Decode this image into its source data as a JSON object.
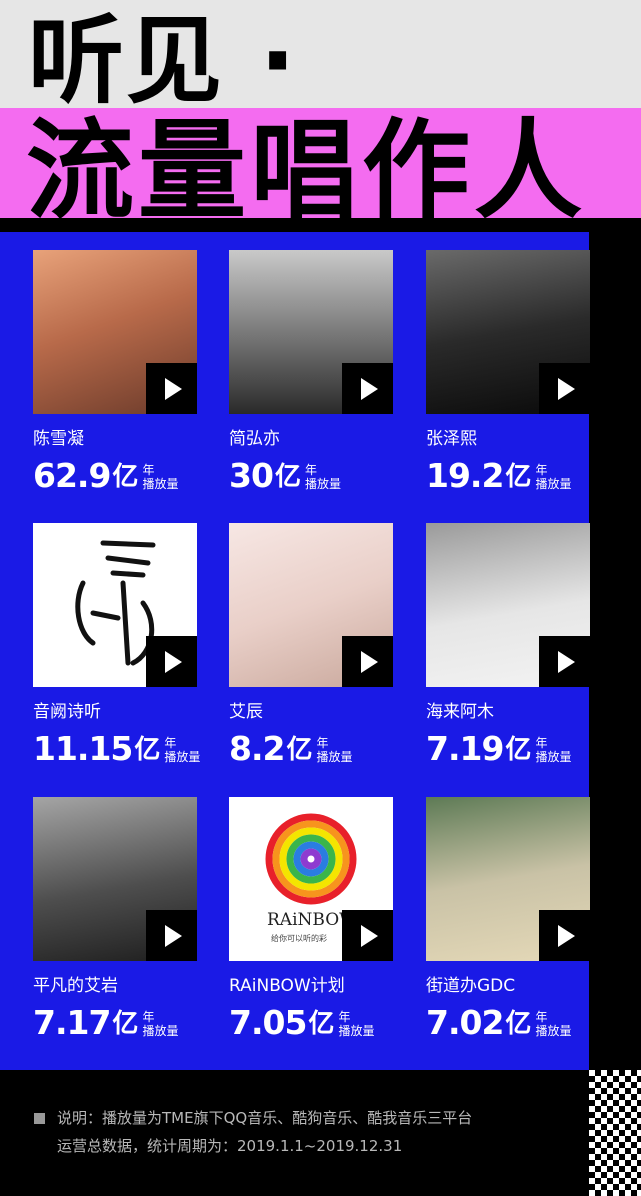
{
  "header": {
    "title_line1": "听见 ·",
    "title_line2": "流量唱作人"
  },
  "colors": {
    "panel": "#1a1ae6",
    "accent_pink": "#f46cf0",
    "header_gray": "#e6e6e6"
  },
  "artists": [
    {
      "name": "陈雪凝",
      "value": "62.9",
      "unit": "亿",
      "label_top": "年",
      "label_bottom": "播放量"
    },
    {
      "name": "简弘亦",
      "value": "30",
      "unit": "亿",
      "label_top": "年",
      "label_bottom": "播放量"
    },
    {
      "name": "张泽熙",
      "value": "19.2",
      "unit": "亿",
      "label_top": "年",
      "label_bottom": "播放量"
    },
    {
      "name": "音阙诗听",
      "value": "11.15",
      "unit": "亿",
      "label_top": "年",
      "label_bottom": "播放量"
    },
    {
      "name": "艾辰",
      "value": "8.2",
      "unit": "亿",
      "label_top": "年",
      "label_bottom": "播放量"
    },
    {
      "name": "海来阿木",
      "value": "7.19",
      "unit": "亿",
      "label_top": "年",
      "label_bottom": "播放量"
    },
    {
      "name": "平凡的艾岩",
      "value": "7.17",
      "unit": "亿",
      "label_top": "年",
      "label_bottom": "播放量"
    },
    {
      "name": "RAiNBOW计划",
      "value": "7.05",
      "unit": "亿",
      "label_top": "年",
      "label_bottom": "播放量"
    },
    {
      "name": "街道办GDC",
      "value": "7.02",
      "unit": "亿",
      "label_top": "年",
      "label_bottom": "播放量"
    }
  ],
  "note": {
    "line1": "说明：播放量为TME旗下QQ音乐、酷狗音乐、酷我音乐三平台",
    "line2": "运营总数据，统计周期为：2019.1.1~2019.12.31"
  }
}
